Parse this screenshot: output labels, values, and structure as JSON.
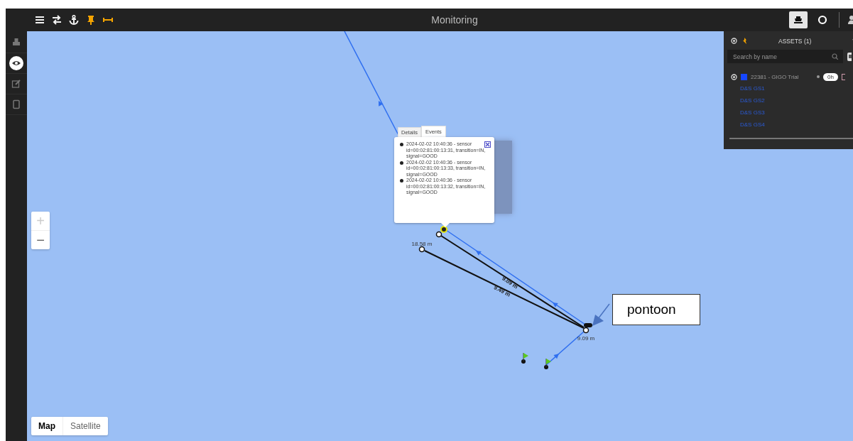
{
  "top_bar": {
    "title": "Monitoring",
    "tools": [
      {
        "kind": "menu"
      },
      {
        "kind": "swap"
      },
      {
        "kind": "anchor"
      },
      {
        "kind": "pin"
      },
      {
        "kind": "measure"
      }
    ],
    "views": [
      {
        "kind": "vessel",
        "selected": true
      },
      {
        "kind": "circle",
        "selected": false
      }
    ]
  },
  "sidebar": {
    "items": [
      {
        "kind": "cubes",
        "selected": false
      },
      {
        "kind": "eye",
        "selected": true
      },
      {
        "kind": "edit",
        "selected": false
      },
      {
        "kind": "tablet",
        "selected": false
      }
    ]
  },
  "map": {
    "zoom": [
      {
        "label": "+",
        "disabled": true
      },
      {
        "label": "−",
        "disabled": false
      }
    ],
    "distance_labels": [
      "18.58 m",
      "9.09 m",
      "9.49 m",
      "9.09 m"
    ],
    "callout": "pontoon",
    "popup": {
      "tabs": [
        {
          "label": "Details",
          "selected": false
        },
        {
          "label": "Events",
          "selected": true
        }
      ],
      "events": [
        "2024-02-02 10:40:36 - sensor id=00:02:81:00:13:31, transition=IN, signal=GOOD",
        "2024-02-02 10:40:36 - sensor id=00:02:81:00:13:33, transition=IN, signal=GOOD",
        "2024-02-02 10:40:36 - sensor id=00:02:81:00:13:32, transition=IN, signal=GOOD"
      ]
    },
    "map_type": [
      {
        "label": "Map",
        "selected": true
      },
      {
        "label": "Satellite",
        "selected": false
      }
    ]
  },
  "assets_panel": {
    "title": "ASSETS (1)",
    "search": {
      "placeholder": "Search by name"
    },
    "assets": [
      {
        "name": "22381 - GIGO Trial",
        "color": "#1546ff",
        "duration": "0h",
        "children": [
          {
            "name": "D&S GS1"
          },
          {
            "name": "D&S GS2"
          },
          {
            "name": "D&S GS3"
          },
          {
            "name": "D&S GS4"
          }
        ]
      }
    ]
  }
}
